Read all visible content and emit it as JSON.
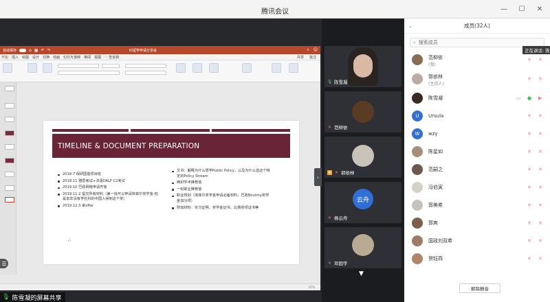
{
  "window": {
    "title": "腾讯会议"
  },
  "ppt": {
    "autosave_label": "自动保存",
    "doc_title": "IO留学申请分享会",
    "tabs": [
      "开始",
      "插入",
      "绘图",
      "设计",
      "切换",
      "动画",
      "幻灯片放映",
      "审阅",
      "视图",
      "♡ 告诉我"
    ],
    "share_label": "共享",
    "comments_label": "批注",
    "slide": {
      "title": "TIMELINE & DOCUMENT PREPARATION",
      "left_bullets": [
        "2018.7 保研国能项目班",
        "2018.11 雅思考试+法语DALF C2考试",
        "2019.10 巴政网络申请开放",
        "2019.11.2 提交所有材料（第一批可以申请埃菲尔奖学金-但是去年没有学社科的中国人得到这个奖）",
        "2019.12.3 拿offer"
      ],
      "right_bullets": [
        "文书：解释为什么想学Public Policy，以及为什么选这个特定的Policy Stream",
        "两封学术推荐信",
        "一封职业推荐信",
        "职业规划（埃菲尔奖学金申请必备材料，巴政Boutmy奖学金加分项）",
        "附加材料：实习证明、奖学金证书、比赛奖项证书等"
      ]
    },
    "zoom": "67%"
  },
  "share": {
    "sharer_label": "陈雪凝的屏幕共享"
  },
  "videos": [
    {
      "name": "陈雪凝"
    },
    {
      "name": "范柳依"
    },
    {
      "name": "郭依林"
    },
    {
      "name": "杨云舟",
      "avatar_text": "云舟"
    },
    {
      "name": "邓固宇"
    }
  ],
  "members": {
    "header": "成员(32人)",
    "search_placeholder": "搜索成员",
    "speaking_label": "正在讲话: 陈",
    "list": [
      {
        "name": "范柳依",
        "sub": "(我)"
      },
      {
        "name": "郭依林",
        "sub": "(主持人)"
      },
      {
        "name": "陈雪凝",
        "sub": ""
      },
      {
        "name": "Ursula",
        "sub": "",
        "initial": "U"
      },
      {
        "name": "wzy",
        "sub": "",
        "initial": "W"
      },
      {
        "name": "陈星如",
        "sub": ""
      },
      {
        "name": "范嗣之",
        "sub": ""
      },
      {
        "name": "冯伯寅",
        "sub": ""
      },
      {
        "name": "郭美希",
        "sub": ""
      },
      {
        "name": "郭爽",
        "sub": ""
      },
      {
        "name": "国政刘双希",
        "sub": ""
      },
      {
        "name": "贺钰燕",
        "sub": ""
      }
    ],
    "unmute_all_label": "解除静音"
  },
  "colors": {
    "ppt_accent": "#b7472a",
    "slide_banner": "#6a2438",
    "avatar_blue": "#2f6fd6",
    "mic_muted": "#e47f7f",
    "mic_active": "#3fbf5a"
  }
}
